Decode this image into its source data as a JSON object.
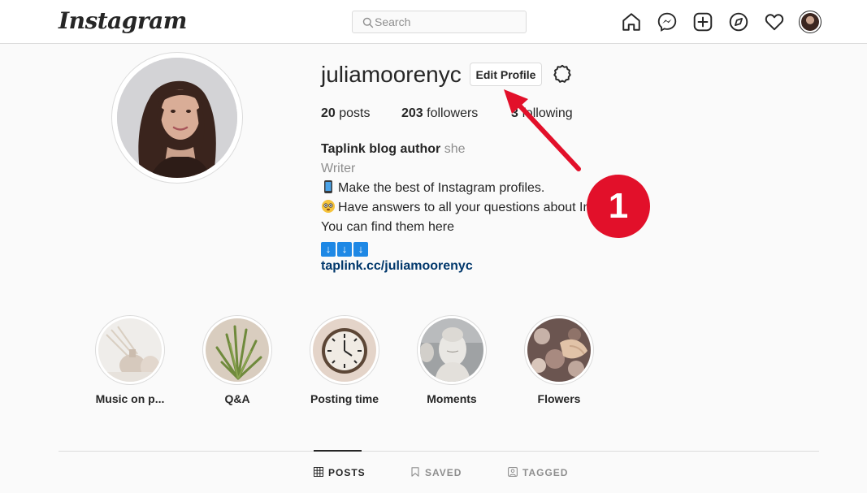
{
  "header": {
    "logo_text": "Instagram",
    "search": {
      "placeholder": "Search",
      "value": ""
    },
    "nav_icons": [
      "home-icon",
      "messenger-icon",
      "new-post-icon",
      "explore-icon",
      "activity-heart-icon",
      "profile-avatar"
    ]
  },
  "profile": {
    "username": "juliamoorenyc",
    "edit_profile_label": "Edit Profile",
    "stats": {
      "posts_count": "20",
      "posts_label": "posts",
      "followers_count": "203",
      "followers_label": "followers",
      "following_count": "3",
      "following_label": "following"
    },
    "bio": {
      "name": "Taplink blog author",
      "pronoun": "she",
      "category": "Writer",
      "line1": "Make the best of Instagram profiles.",
      "line2": "Have answers to all your questions about Instagram.",
      "line3": "You can find them here",
      "arrows": [
        "↓",
        "↓",
        "↓"
      ],
      "link": "taplink.cc/juliamoorenyc"
    }
  },
  "annotation": {
    "badge_number": "1",
    "color": "#e2102a"
  },
  "highlights": [
    {
      "label": "Music on p..."
    },
    {
      "label": "Q&A"
    },
    {
      "label": "Posting time"
    },
    {
      "label": "Moments"
    },
    {
      "label": "Flowers"
    }
  ],
  "tabs": [
    {
      "label": "POSTS",
      "active": true
    },
    {
      "label": "SAVED",
      "active": false
    },
    {
      "label": "TAGGED",
      "active": false
    }
  ],
  "colors": {
    "link": "#00376b",
    "secondary_text": "#8e8e8e",
    "border": "#dbdbdb",
    "arrow_emoji_bg": "#1e88e5"
  }
}
